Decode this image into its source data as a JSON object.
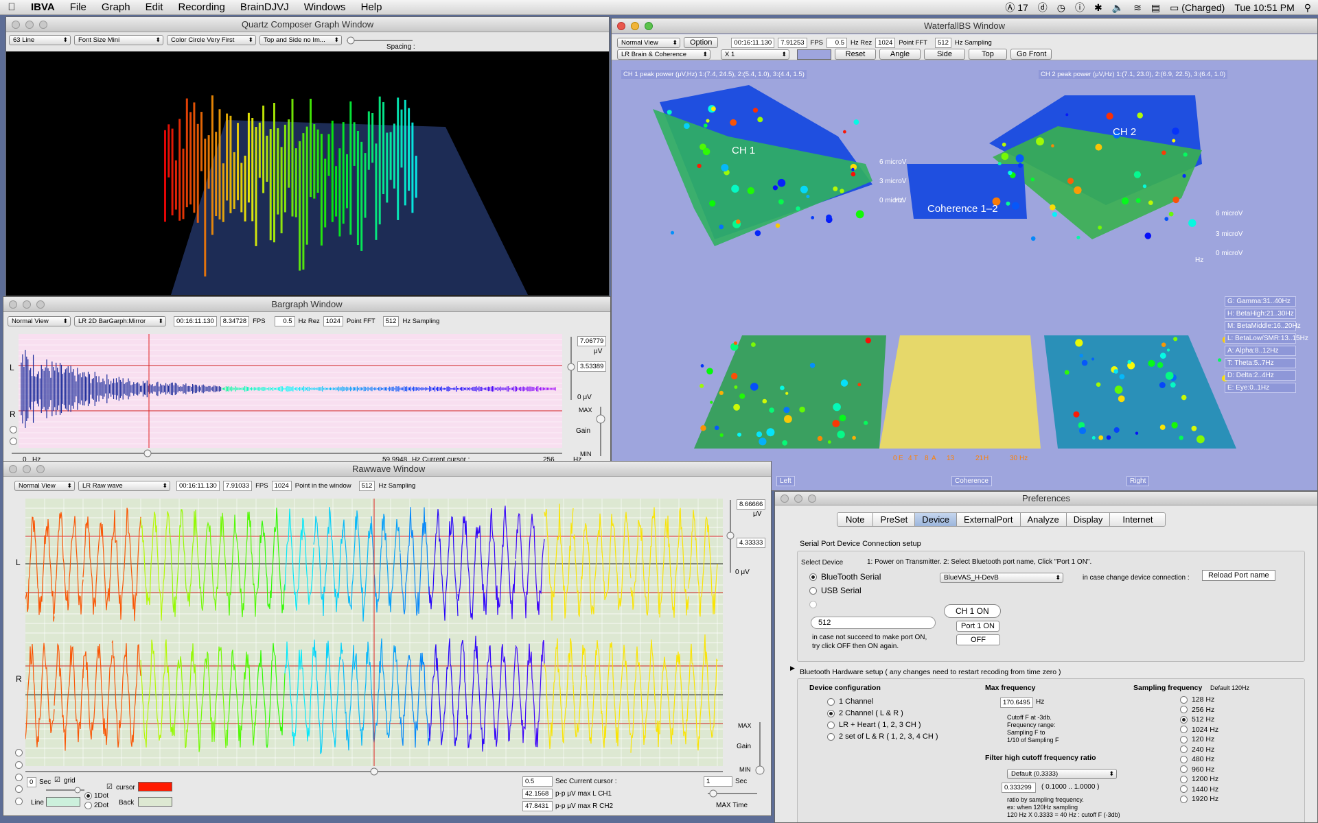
{
  "menubar": {
    "app": "IBVA",
    "items": [
      "File",
      "Graph",
      "Edit",
      "Recording",
      "BrainDJVJ",
      "Windows",
      "Help"
    ],
    "status_ai": "17",
    "battery": "(Charged)",
    "clock": "Tue 10:51 PM"
  },
  "quartz": {
    "title": "Quartz Composer Graph Window",
    "popups": [
      "63 Line",
      "Font Size Mini",
      "Color Circle Very First",
      "Top and Side no Im..."
    ],
    "spacing_label": "Spacing :"
  },
  "bargraph": {
    "title": "Bargraph Window",
    "view": "Normal View",
    "mode": "LR 2D BarGarph:Mirror",
    "time": "00:16:11.130",
    "fps_value": "8.34728",
    "fps_label": "FPS",
    "hzrez_value": "0.5",
    "hzrez_label": "Hz Rez",
    "fft_value": "1024",
    "fft_label": "Point FFT",
    "sampling_value": "512",
    "sampling_label": "Hz Sampling",
    "scale_top": "7.06779",
    "scale_unit": "μV",
    "scale_mid": "3.53389",
    "scale_zero": "0 μV",
    "ch_l": "L",
    "ch_r": "R",
    "max_label": "MAX",
    "gain_label": "Gain",
    "min_label": "MIN",
    "bottom_zero": "0",
    "bottom_hz": "Hz",
    "bottom_val": "59.9948",
    "bottom_cursor": "Hz Current cursor :",
    "bottom_256": "256",
    "bottom_hz2": "Hz"
  },
  "rawwave": {
    "title": "Rawwave Window",
    "view": "Normal View",
    "mode": "LR Raw wave",
    "time": "00:16:11.130",
    "fps_value": "7.91033",
    "fps_label": "FPS",
    "points_value": "1024",
    "points_label": "Point in the window",
    "sampling_value": "512",
    "sampling_label": "Hz Sampling",
    "scale_top": "8.66666",
    "scale_unit": "μV",
    "scale_mid": "4.33333",
    "scale_zero": "0 μV",
    "ch_l": "L",
    "ch_r": "R",
    "max_label": "MAX",
    "gain_label": "Gain",
    "min_label": "MIN",
    "sec_value": "0",
    "sec_label": "Sec",
    "grid_label": "grid",
    "line_label": "Line",
    "dot1": "1Dot",
    "dot2": "2Dot",
    "cursor_label": "cursor",
    "back_label": "Back",
    "cursor_sec_value": "0.5",
    "cursor_sec_label": "Sec Current cursor :",
    "pp_l_value": "42.1568",
    "pp_l_label": "p-p μV max L CH1",
    "pp_r_value": "47.8431",
    "pp_r_label": "p-p μV max R CH2",
    "max_time_value": "1",
    "max_time_unit": "Sec",
    "max_time_label": "MAX Time",
    "cursor_color": "#ff1a00",
    "line_color": "#ccf0dc",
    "back_color": "#dde8d2"
  },
  "waterfall": {
    "title": "WaterfallBS Window",
    "view": "Normal View",
    "option": "Option",
    "time": "00:16:11.130",
    "fps_value": "7.91253",
    "fps_label": "FPS",
    "hzrez_value": "0.5",
    "hzrez_label": "Hz Rez",
    "fft_value": "1024",
    "fft_label": "Point FFT",
    "sampling_value": "512",
    "sampling_label": "Hz Sampling",
    "mode": "LR Brain & Coherence",
    "zoom": "X 1",
    "buttons": [
      "Reset",
      "Angle",
      "Side",
      "Top",
      "Go Front"
    ],
    "ch1_peak": "CH 1 peak power (μV,Hz) 1:(7.4, 24.5), 2:(5.4, 1.0), 3:(4.4, 1.5)",
    "ch2_peak": "CH 2 peak power (μV,Hz) 1:(7.1, 23.0), 2:(6.9, 22.5), 3:(6.4, 1.0)",
    "ch1_label": "CH 1",
    "ch2_label": "CH 2",
    "coherence_label": "Coherence 1–2",
    "ch1_axis": [
      "6 microV",
      "3 microV",
      "0 microV",
      "Hz"
    ],
    "ch2_axis": [
      "6 microV",
      "3 microV",
      "0 microV",
      "Hz"
    ],
    "bands": [
      "G: Gamma:31..40Hz",
      "H: BetaHigh:21..30Hz",
      "M: BetaMiddle:16..20Hz",
      "L: BetaLow/SMR:13..15Hz",
      "A: Alpha:8..12Hz",
      "T: Theta:5..7Hz",
      "D: Delta:2..4Hz",
      "E: Eye:0..1Hz"
    ],
    "bottom_labels": [
      "Left",
      "Coherence",
      "Right"
    ],
    "hz_axis": [
      "0",
      "E",
      "4",
      "T",
      "8",
      "A",
      "13",
      "21",
      "H",
      "30",
      "Hz"
    ]
  },
  "preferences": {
    "title": "Preferences",
    "tabs": [
      "Note",
      "PreSet",
      "Device",
      "ExternalPort",
      "Analyze",
      "Display",
      "Internet"
    ],
    "selected_tab": "Device",
    "serial_title": "Serial Port Device Connection setup",
    "select_device": "Select Device",
    "instructions": "1: Power on Transmitter.   2: Select Bluetooth port name, Click \"Port 1 ON\".",
    "device_options": [
      "BlueTooth Serial",
      "USB Serial",
      ""
    ],
    "port_name": "BlueVAS_H-DevB",
    "change_label": "in case change device connection :",
    "reload_button": "Reload Port name",
    "ch_on": "CH 1 ON",
    "baud": "512",
    "port_on": "Port 1 ON",
    "off": "OFF",
    "fail_note_1": "in case not succeed to make port ON,",
    "fail_note_2": "try click OFF then ON again.",
    "bt_title": "Bluetooth Hardware setup ( any changes need to restart recoding from time zero )",
    "devconf_title": "Device configuration",
    "devconf_options": [
      "1 Channel",
      "2 Channel ( L & R )",
      "LR + Heart ( 1, 2, 3 CH )",
      "2 set of L & R ( 1, 2, 3, 4 CH )"
    ],
    "devconf_selected": 1,
    "maxfreq_title": "Max frequency",
    "maxfreq_value": "170.6495",
    "maxfreq_unit": "Hz",
    "maxfreq_note": [
      "Cutoff F at -3db.",
      "Frequency range:",
      "Sampling F to",
      "1/10 of Sampling F"
    ],
    "filter_title": "Filter high cutoff frequency ratio",
    "filter_popup": "Default (0.3333)",
    "filter_value": "0.333299",
    "filter_range": "( 0.1000 .. 1.0000 )",
    "filter_note": [
      "ratio by sampling frequency.",
      "ex: when 120Hz sampling",
      "120 Hz X 0.3333 = 40 Hz : cutoff F (-3db)"
    ],
    "sampling_title": "Sampling frequency",
    "sampling_default": "Default 120Hz",
    "sampling_options": [
      "128 Hz",
      "256 Hz",
      "512 Hz",
      "1024 Hz",
      "120 Hz",
      "240 Hz",
      "480 Hz",
      "960 Hz",
      "1200 Hz",
      "1440 Hz",
      "1920 Hz"
    ],
    "sampling_selected": 2
  }
}
